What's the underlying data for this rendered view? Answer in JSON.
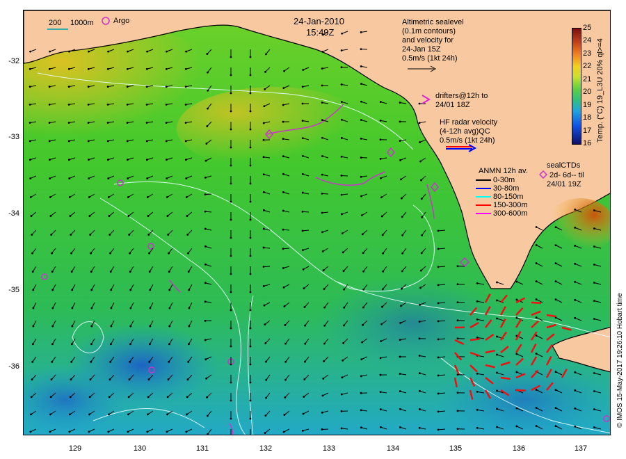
{
  "header": {
    "date": "24-Jan-2010",
    "time": "15:49Z"
  },
  "legend_top_left": {
    "scale": "200",
    "depth": "1000m",
    "argo": "Argo"
  },
  "altimetry": {
    "lines": [
      "Altimetric sealevel",
      "(0.1m contours)",
      "and velocity for",
      "24-Jan 15Z",
      "0.5m/s (1kt 24h)"
    ]
  },
  "drifters": {
    "lines": [
      "drifters@12h to",
      "24/01 18Z"
    ]
  },
  "hf_radar": {
    "lines": [
      "HF radar velocity",
      "(4-12h avg)QC",
      "0.5m/s (1kt 24h)"
    ]
  },
  "anmn": {
    "title": "ANMN 12h av.",
    "items": [
      {
        "label": "0-30m",
        "color": "#000000"
      },
      {
        "label": "30-80m",
        "color": "#0000ff"
      },
      {
        "label": "80-150m",
        "color": "#00ffff"
      },
      {
        "label": "150-300m",
        "color": "#ff0000"
      },
      {
        "label": "300-600m",
        "color": "#ff00ff"
      }
    ]
  },
  "sealctds": {
    "lines": [
      "sealCTDs",
      "2d- 6d-- til",
      "24/01 19Z"
    ]
  },
  "colorbar": {
    "title": "Temp. (°C) 19_L3U 20% ql>=4",
    "ticks": [
      "25",
      "24",
      "23",
      "22",
      "21",
      "20",
      "19",
      "18",
      "17",
      "16"
    ]
  },
  "axes": {
    "lat_labels": [
      "-32",
      "-33",
      "-34",
      "-35",
      "-36"
    ],
    "lon_labels": [
      "129",
      "130",
      "131",
      "132",
      "133",
      "134",
      "135",
      "136",
      "137"
    ]
  },
  "credit": "© IMOS 15-May-2017 19:26:10 Hobart time",
  "colors": {
    "land": "#f8c9a0",
    "sea_warm": "#33cc22",
    "sea_cool": "#2299ee",
    "arrow": "#000000",
    "hf_arrow": "#ff0000"
  }
}
